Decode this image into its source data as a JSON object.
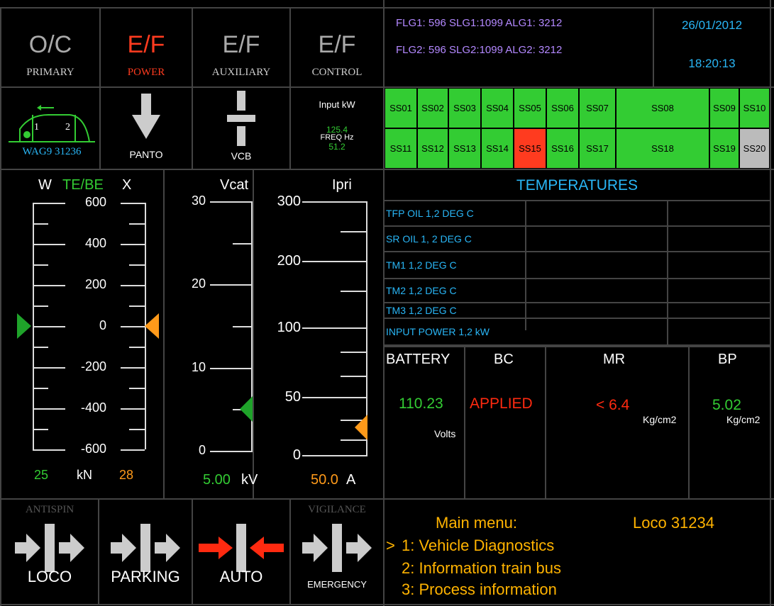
{
  "top_status": [
    {
      "code": "O/C",
      "label": "PRIMARY",
      "code_color": "#aaaaaa",
      "label_color": "#cccccc"
    },
    {
      "code": "E/F",
      "label": "POWER",
      "code_color": "#ff3b1f",
      "label_color": "#ff3b1f"
    },
    {
      "code": "E/F",
      "label": "AUXILIARY",
      "code_color": "#aaaaaa",
      "label_color": "#cccccc"
    },
    {
      "code": "E/F",
      "label": "CONTROL",
      "code_color": "#aaaaaa",
      "label_color": "#cccccc"
    }
  ],
  "flg_line1": "FLG1:  596 SLG1:1099 ALG1: 3212",
  "flg_line2": "FLG2: 596  SLG2:1099 ALG2: 3212",
  "date": "26/01/2012",
  "time": "18:20:13",
  "loco_diagram": {
    "cab1": "1",
    "cab2": "2",
    "label": "WAG9 31236"
  },
  "panto_label": "PANTO",
  "vcb_label": "VCB",
  "input_kw_label": "Input  kW",
  "input_kw_value": "125.4",
  "freq_label": "FREQ  Hz",
  "freq_value": "51.2",
  "subsystems_row1": [
    {
      "id": "SS01",
      "state": "ok"
    },
    {
      "id": "SS02",
      "state": "ok"
    },
    {
      "id": "SS03",
      "state": "ok"
    },
    {
      "id": "SS04",
      "state": "ok"
    },
    {
      "id": "SS05",
      "state": "ok"
    },
    {
      "id": "SS06",
      "state": "ok"
    },
    {
      "id": "SS07",
      "state": "ok"
    },
    {
      "id": "SS08",
      "state": "ok"
    },
    {
      "id": "SS09",
      "state": "ok"
    },
    {
      "id": "SS10",
      "state": "ok"
    }
  ],
  "subsystems_row2": [
    {
      "id": "SS11",
      "state": "ok"
    },
    {
      "id": "SS12",
      "state": "ok"
    },
    {
      "id": "SS13",
      "state": "ok"
    },
    {
      "id": "SS14",
      "state": "ok"
    },
    {
      "id": "SS15",
      "state": "fault"
    },
    {
      "id": "SS16",
      "state": "ok"
    },
    {
      "id": "SS17",
      "state": "ok"
    },
    {
      "id": "SS18",
      "state": "ok"
    },
    {
      "id": "SS19",
      "state": "ok"
    },
    {
      "id": "SS20",
      "state": "off"
    }
  ],
  "ss_colors": {
    "ok": "#33cc33",
    "fault": "#ff3b1f",
    "off": "#bbbbbb"
  },
  "te_gauge": {
    "w_label": "W",
    "te_label": "TE/BE",
    "x_label": "X",
    "ticks": [
      "600",
      "400",
      "200",
      "0",
      "-200",
      "-400",
      "-600"
    ],
    "range": [
      -600,
      600
    ],
    "left_marker": 0,
    "right_marker": 0,
    "left_value": "25",
    "unit": "kN",
    "right_value": "28"
  },
  "vcat_gauge": {
    "title": "Vcat",
    "ticks": [
      "30",
      "20",
      "10",
      "0"
    ],
    "range": [
      0,
      30
    ],
    "marker": 5,
    "value": "5.00",
    "unit": "kV"
  },
  "ipri_gauge": {
    "title": "Ipri",
    "ticks": [
      "300",
      "200",
      "100",
      "50",
      "0"
    ],
    "marker": 50,
    "value": "50.0",
    "unit": "A"
  },
  "temperatures_title": "TEMPERATURES",
  "temperature_rows": [
    {
      "name": "TFP OIL 1,2 DEG C",
      "v1": "",
      "v2": ""
    },
    {
      "name": "SR OIL 1, 2 DEG C",
      "v1": "",
      "v2": ""
    },
    {
      "name": "TM1 1,2 DEG C",
      "v1": "",
      "v2": ""
    },
    {
      "name": "TM2 1,2 DEG C",
      "v1": "",
      "v2": ""
    },
    {
      "name": "TM3 1,2 DEG C",
      "v1": "",
      "v2": ""
    },
    {
      "name": "INPUT POWER 1,2 kW",
      "v1": "",
      "v2": ""
    }
  ],
  "battery": {
    "title": "BATTERY",
    "value": "110.23",
    "unit": "Volts"
  },
  "bc": {
    "title": "BC",
    "value": "APPLIED"
  },
  "mr": {
    "title": "MR",
    "value": "< 6.4",
    "unit": "Kg/cm2"
  },
  "bp": {
    "title": "BP",
    "value": "5.02",
    "unit": "Kg/cm2"
  },
  "bottom_controls": [
    {
      "top": "ANTISPIN",
      "label": "LOCO",
      "arrow_color": "#cccccc",
      "dir": "out"
    },
    {
      "top": "",
      "label": "PARKING",
      "arrow_color": "#cccccc",
      "dir": "out"
    },
    {
      "top": "",
      "label": "AUTO",
      "arrow_color": "#ff2a10",
      "dir": "in"
    },
    {
      "top": "VIGILANCE",
      "label": "EMERGENCY",
      "arrow_color": "#cccccc",
      "dir": "out"
    }
  ],
  "menu": {
    "title": "Main menu:",
    "loco": "Loco  31234",
    "cursor": ">",
    "items": [
      "1: Vehicle Diagnostics",
      "2: Information train bus",
      "3: Process information"
    ]
  }
}
